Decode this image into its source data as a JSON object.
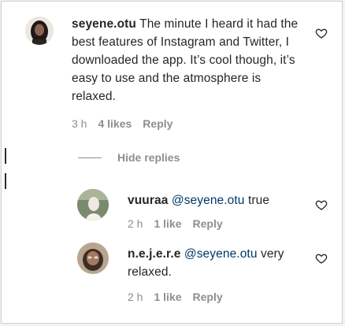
{
  "comment": {
    "username": "seyene.otu",
    "text": "The minute I heard it had the best features of Instagram and Twitter, I downloaded the app. It’s cool though, it’s easy to use and the atmosphere is relaxed.",
    "time": "3 h",
    "likes": "4 likes",
    "reply_label": "Reply"
  },
  "hide_replies_label": "Hide replies",
  "replies": [
    {
      "username": "vuuraa",
      "mention": "@seyene.otu",
      "text": "true",
      "time": "2 h",
      "likes": "1 like",
      "reply_label": "Reply"
    },
    {
      "username": "n.e.j.e.r.e",
      "mention": "@seyene.otu",
      "text": "very relaxed.",
      "time": "2 h",
      "likes": "1 like",
      "reply_label": "Reply"
    }
  ],
  "icons": {
    "like": "heart-outline-icon"
  },
  "colors": {
    "text": "#262626",
    "meta": "#8e8e8e",
    "mention": "#00376b"
  }
}
